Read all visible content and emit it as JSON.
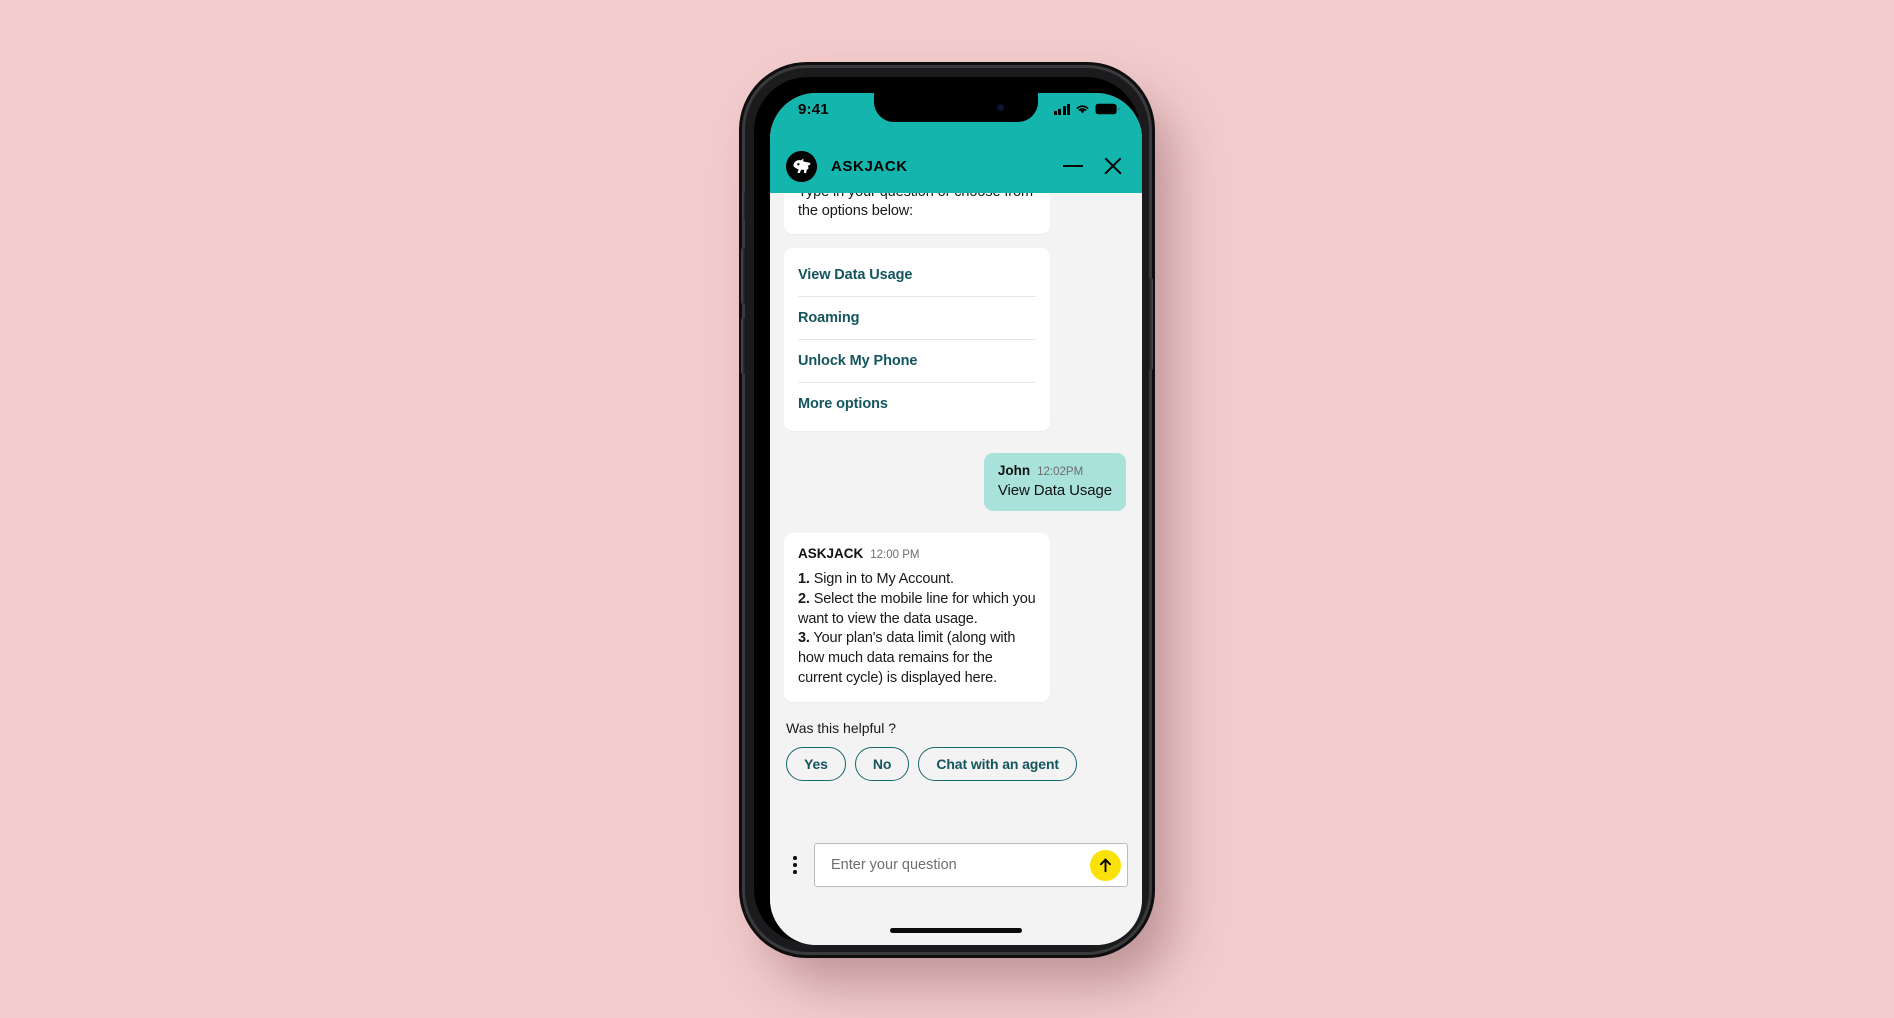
{
  "theme": {
    "page_background": "#f2cbcd",
    "brand_teal": "#14b5ad",
    "link_teal": "#14555e",
    "user_bubble": "#a9e2da",
    "send_yellow": "#fbe10a"
  },
  "status_bar": {
    "time": "9:41",
    "signal_icon": "signal-bars-icon",
    "wifi_icon": "wifi-icon",
    "battery_icon": "battery-icon"
  },
  "header": {
    "title": "ASKJACK",
    "logo_icon": "askjack-dog-logo-icon",
    "minimize_icon": "minimize-icon",
    "close_icon": "close-icon"
  },
  "conversation": {
    "intro_message": "Type in your question or choose from the options below:",
    "options": [
      {
        "label": "View Data Usage"
      },
      {
        "label": "Roaming"
      },
      {
        "label": "Unlock My Phone"
      },
      {
        "label": "More options"
      }
    ],
    "user_message": {
      "author": "John",
      "time": "12:02PM",
      "text": "View Data Usage"
    },
    "bot_answer": {
      "author": "ASKJACK",
      "time": "12:00 PM",
      "steps": [
        {
          "number": "1.",
          "text": "Sign in to My Account."
        },
        {
          "number": "2.",
          "text": "Select the mobile line for which you want to view the data usage."
        },
        {
          "number": "3.",
          "text": "Your plan's data limit (along with how much data remains for the current cycle) is displayed here."
        }
      ]
    }
  },
  "feedback": {
    "prompt": "Was this helpful ?",
    "buttons": [
      {
        "label": "Yes"
      },
      {
        "label": "No"
      },
      {
        "label": "Chat with an agent"
      }
    ]
  },
  "composer": {
    "overflow_icon": "vertical-dots-icon",
    "placeholder": "Enter your question",
    "value": "",
    "send_icon": "arrow-up-icon"
  }
}
